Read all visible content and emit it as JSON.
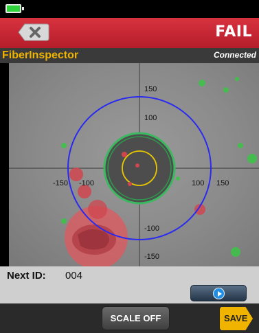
{
  "header": {
    "result": "FAIL",
    "back_icon": "close-back-icon"
  },
  "app_bar": {
    "title": "FiberInspector",
    "status": "Connected"
  },
  "scale": {
    "x_ticks": [
      "-150",
      "-100",
      "100",
      "150"
    ],
    "y_ticks": [
      "150",
      "100",
      "-100",
      "-150"
    ]
  },
  "info": {
    "next_id_label": "Next ID:",
    "next_id_value": "004"
  },
  "controls": {
    "scale_button": "SCALE OFF",
    "save_button": "SAVE"
  },
  "colors": {
    "fail_red": "#c8282f",
    "accent_yellow": "#f0b400",
    "cladding_ring": "#2a2af0",
    "core_ring": "#e8c800"
  }
}
